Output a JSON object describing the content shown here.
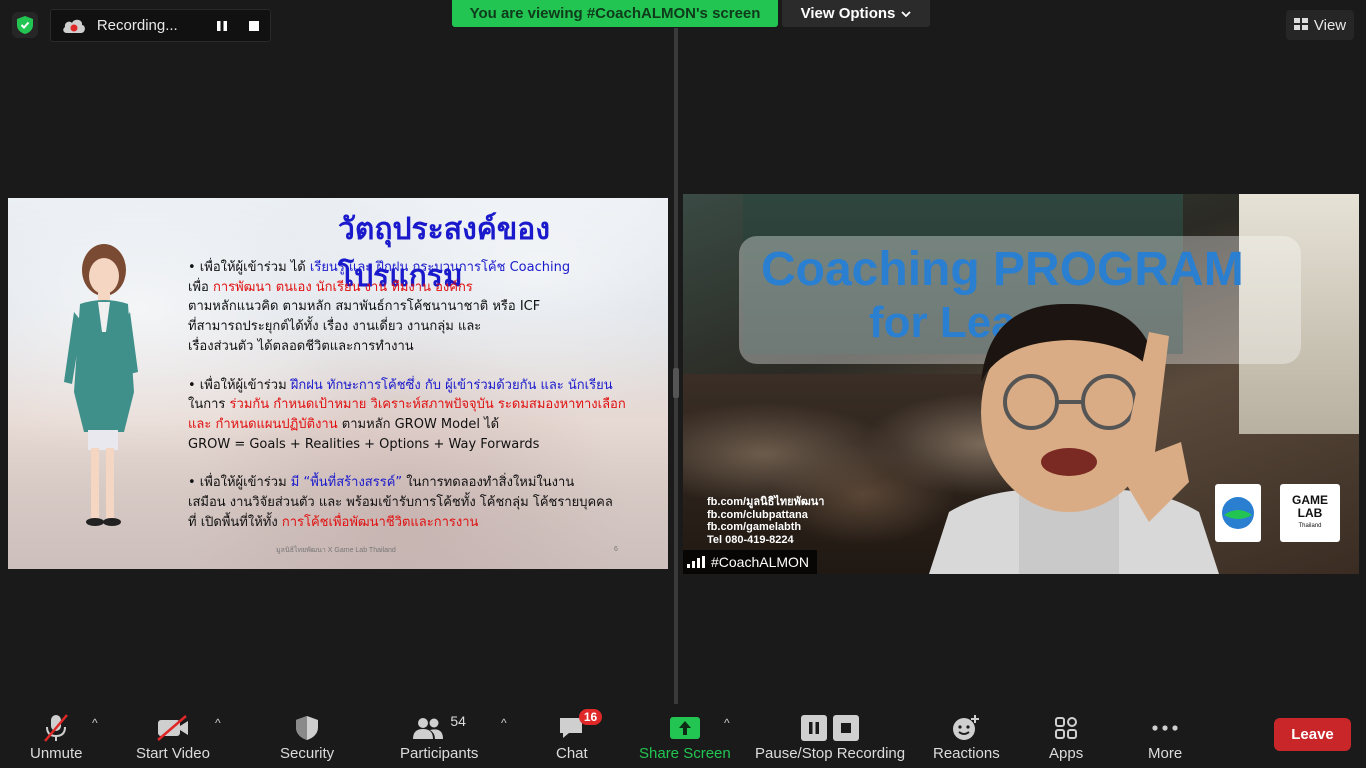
{
  "recording": {
    "label": "Recording..."
  },
  "banner": {
    "viewing": "You are viewing #CoachALMON's screen",
    "view_options": "View Options"
  },
  "view_button": {
    "label": "View"
  },
  "slide": {
    "title": "วัตถุประสงค์ของโปรแกรม",
    "footer": "มูลนิธิไทยพัฒนา X Game Lab Thailand",
    "page_number": "6",
    "lines": {
      "l1a": "• เพื่อให้ผู้เข้าร่วม ได้ ",
      "l1b": "เรียนรู้ และ ฝึกฝน กระบวนการโค้ช Coaching",
      "l2a": "เพื่อ ",
      "l2b": "การพัฒนา ตนเอง นักเรียน งาน ทีมงาน องค์กร",
      "l3": "ตามหลักแนวคิด ตามหลัก สมาพันธ์การโค้ชนานาชาติ หรือ ICF",
      "l4": "ที่สามารถประยุกต์ได้ทั้ง เรื่อง งานเดี่ยว งานกลุ่ม และ",
      "l5": "เรื่องส่วนตัว ได้ตลอดชีวิตและการทำงาน",
      "l6a": "• เพื่อให้ผู้เข้าร่วม ",
      "l6b": "ฝึกฝน ทักษะการโค้ชซึ่ง กับ ผู้เข้าร่วมด้วยกัน และ นักเรียน",
      "l7a": "ในการ ",
      "l7b": "ร่วมกัน กำหนดเป้าหมาย วิเคราะห์สภาพปัจจุบัน ระดมสมองหาทางเลือก",
      "l8a": "และ กำหนดแผนปฏิบัติงาน",
      "l8b": " ตามหลัก GROW Model ได้",
      "l9": "GROW = Goals + Realities + Options + Way Forwards",
      "l10a": "• เพื่อให้ผู้เข้าร่วม ",
      "l10b": "มี “พื้นที่สร้างสรรค์”",
      "l10c": " ในการทดลองทำสิ่งใหม่ในงาน",
      "l11": "เสมือน งานวิจัยส่วนตัว และ พร้อมเข้ารับการโค้ชทั้ง โค้ชกลุ่ม โค้ชรายบุคคล",
      "l12a": "ที่ เปิดพื้นที่ให้ทั้ง ",
      "l12b": "การโค้ชเพื่อพัฒนาชีวิตและการงาน"
    }
  },
  "video": {
    "title_line1": "Coaching PROGRAM",
    "title_line2": "for Learer",
    "social": [
      "fb.com/มูลนิธิไทยพัฒนา",
      "fb.com/clubpattana",
      "fb.com/gamelabth",
      "Tel 080-419-8224"
    ],
    "logo_game": "GAME",
    "logo_lab": "LAB",
    "logo_sub": "Thailand",
    "participant_name": "#CoachALMON"
  },
  "toolbar": {
    "unmute": "Unmute",
    "start_video": "Start Video",
    "security": "Security",
    "participants": "Participants",
    "participant_count": "54",
    "chat": "Chat",
    "chat_badge": "16",
    "share_screen": "Share Screen",
    "pause_stop_recording": "Pause/Stop Recording",
    "reactions": "Reactions",
    "apps": "Apps",
    "more": "More",
    "leave": "Leave"
  },
  "colors": {
    "share_green": "#23c552",
    "leave_red": "#c9262a",
    "slide_blue": "#1a1acc",
    "slide_red": "#e01010"
  }
}
